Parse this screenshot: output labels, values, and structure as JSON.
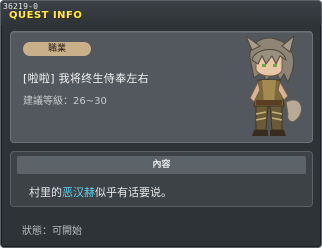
{
  "window": {
    "quest_id": "36219-0",
    "title": "QUEST INFO"
  },
  "card": {
    "job_label": "職業",
    "quest_title": "[啦啦] 我将终生侍奉左右",
    "level_label": "建議等級",
    "level_range": "26~30",
    "npc_icon": "wolf-eared-npc-portrait"
  },
  "content": {
    "header": "內容",
    "text_before": "村里的",
    "npc_name": "恶汉赫",
    "text_after": "似乎有话要说。"
  },
  "status": {
    "label": "狀態",
    "value": "可開始"
  },
  "colors": {
    "title_yellow": "#ffe94a",
    "npc_name_cyan": "#5fd4f0",
    "badge_tan": "#c9b08a",
    "panel_dark": "#2e3337"
  }
}
